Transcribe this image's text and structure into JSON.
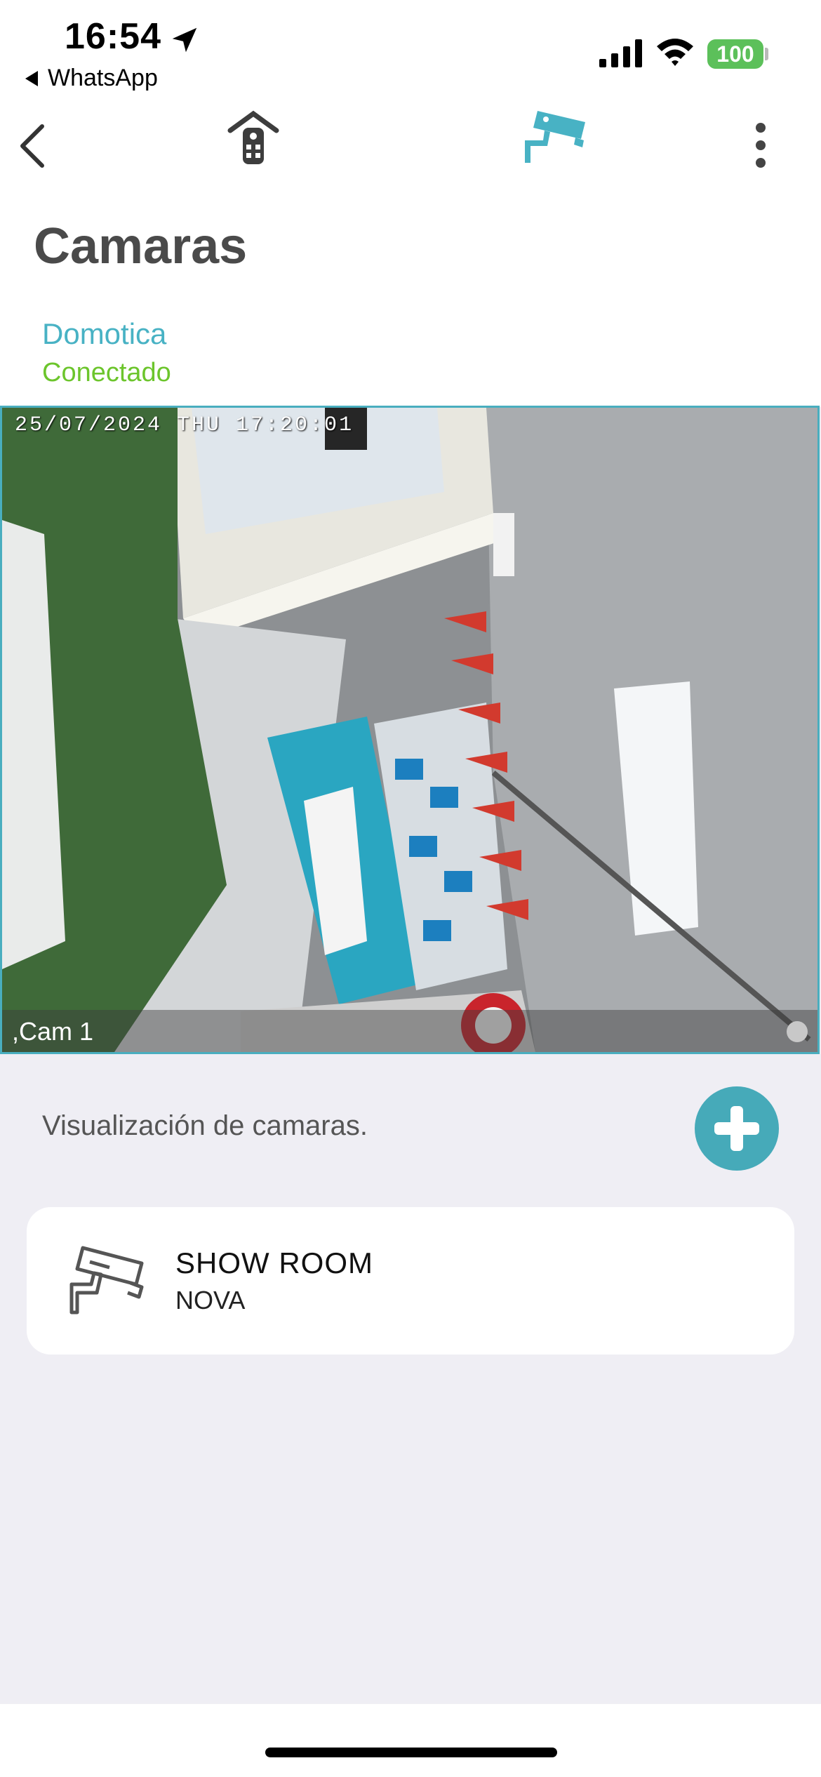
{
  "status_bar": {
    "time": "16:54",
    "back_app": "WhatsApp",
    "battery": "100"
  },
  "nav": {
    "icons": [
      "chevron-left-icon",
      "remote-control-icon",
      "security-camera-icon",
      "more-vertical-icon"
    ],
    "active_color": "#48b2c4"
  },
  "header": {
    "title": "Camaras",
    "device_name": "Domotica",
    "device_status": "Conectado"
  },
  "feed": {
    "osd_text": "25/07/2024 THU 17:20:01",
    "camera_label": ",Cam 1"
  },
  "section": {
    "label": "Visualización de camaras."
  },
  "cameras": [
    {
      "name": "SHOW ROOM",
      "location": "NOVA"
    }
  ],
  "colors": {
    "accent": "#48b2c4",
    "connected": "#6cc52c",
    "background": "#efeef4"
  }
}
